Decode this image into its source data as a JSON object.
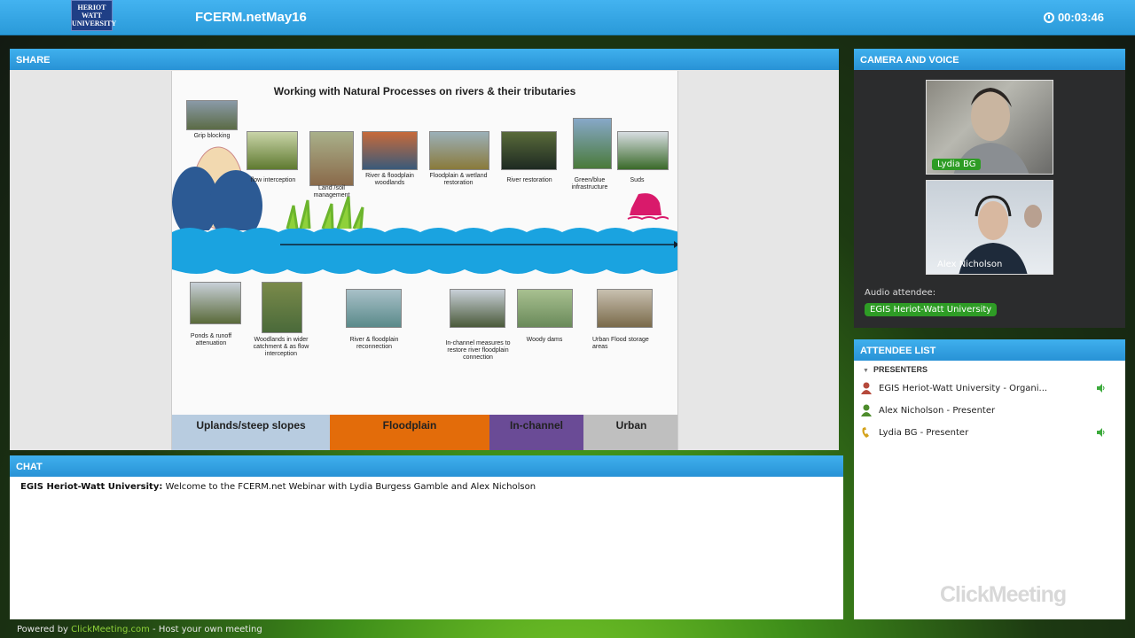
{
  "header": {
    "logo_text": "HERIOT WATT UNIVERSITY",
    "title": "FCERM.netMay16",
    "timer": "00:03:46"
  },
  "share": {
    "label": "SHARE",
    "slide": {
      "title": "Working with Natural Processes on rivers & their tributaries",
      "top_captions": [
        "Grip blocking",
        "flow interception",
        "Land /soil management",
        "River & floodplain woodlands",
        "Floodplain & wetland restoration",
        "River restoration",
        "Green/blue infrastructure",
        "Suds"
      ],
      "bottom_captions": [
        "Ponds & runoff attenuation",
        "Woodlands in wider catchment & as flow interception",
        "River & floodplain reconnection",
        "In-channel measures to restore river floodplain connection",
        "Woody dams",
        "Urban Flood storage areas"
      ],
      "zones": [
        "Uplands/steep slopes",
        "Floodplain",
        "In-channel",
        "Urban"
      ]
    }
  },
  "chat": {
    "label": "CHAT",
    "messages": [
      {
        "author": "EGIS Heriot-Watt University:",
        "text": "Welcome to the FCERM.net Webinar with Lydia Burgess Gamble and Alex Nicholson"
      }
    ]
  },
  "camera": {
    "label": "CAMERA AND VOICE",
    "videos": [
      {
        "name": "Lydia BG"
      },
      {
        "name": "Alex Nicholson"
      }
    ],
    "audio_label": "Audio attendee:",
    "audio_attendee": "EGIS Heriot-Watt University"
  },
  "attendees": {
    "label": "ATTENDEE LIST",
    "group": "PRESENTERS",
    "rows": [
      {
        "name": "EGIS Heriot-Watt University - Organi...",
        "color": "#b5493b"
      },
      {
        "name": "Alex Nicholson - Presenter",
        "color": "#4d8c2b"
      },
      {
        "name": "Lydia BG - Presenter",
        "color": "#d4a21b"
      }
    ],
    "watermark": "ClickMeeting"
  },
  "footer": {
    "prefix": "Powered by",
    "link": "ClickMeeting.com",
    "suffix": "- Host your own meeting"
  }
}
